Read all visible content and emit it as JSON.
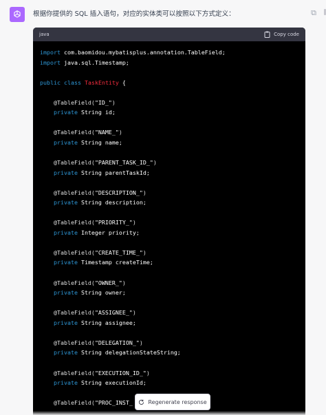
{
  "message": {
    "intro": "根据你提供的 SQL 插入语句，对应的实体类可以按照以下方式定义：",
    "avatar_icon": "openai-logo-icon",
    "avatar_color": "#ab68ff"
  },
  "code_block": {
    "language": "java",
    "copy_label": "Copy code",
    "lines": [
      {
        "parts": [
          {
            "t": "import",
            "c": "kw"
          },
          {
            "t": " com.baomidou.mybatisplus.annotation.TableField;",
            "c": ""
          }
        ]
      },
      {
        "parts": [
          {
            "t": "import",
            "c": "kw"
          },
          {
            "t": " java.sql.Timestamp;",
            "c": ""
          }
        ]
      },
      {
        "parts": []
      },
      {
        "parts": [
          {
            "t": "public",
            "c": "kw"
          },
          {
            "t": " ",
            "c": ""
          },
          {
            "t": "class",
            "c": "kw"
          },
          {
            "t": " ",
            "c": ""
          },
          {
            "t": "TaskEntity",
            "c": "cls"
          },
          {
            "t": " {",
            "c": ""
          }
        ]
      },
      {
        "parts": []
      },
      {
        "parts": [
          {
            "t": "    @TableField(",
            "c": "anno"
          },
          {
            "t": "\"ID_\"",
            "c": "str"
          },
          {
            "t": ")",
            "c": "anno"
          }
        ]
      },
      {
        "parts": [
          {
            "t": "    ",
            "c": ""
          },
          {
            "t": "private",
            "c": "kw"
          },
          {
            "t": " String id;",
            "c": ""
          }
        ]
      },
      {
        "parts": []
      },
      {
        "parts": [
          {
            "t": "    @TableField(",
            "c": "anno"
          },
          {
            "t": "\"NAME_\"",
            "c": "str"
          },
          {
            "t": ")",
            "c": "anno"
          }
        ]
      },
      {
        "parts": [
          {
            "t": "    ",
            "c": ""
          },
          {
            "t": "private",
            "c": "kw"
          },
          {
            "t": " String name;",
            "c": ""
          }
        ]
      },
      {
        "parts": []
      },
      {
        "parts": [
          {
            "t": "    @TableField(",
            "c": "anno"
          },
          {
            "t": "\"PARENT_TASK_ID_\"",
            "c": "str"
          },
          {
            "t": ")",
            "c": "anno"
          }
        ]
      },
      {
        "parts": [
          {
            "t": "    ",
            "c": ""
          },
          {
            "t": "private",
            "c": "kw"
          },
          {
            "t": " String parentTaskId;",
            "c": ""
          }
        ]
      },
      {
        "parts": []
      },
      {
        "parts": [
          {
            "t": "    @TableField(",
            "c": "anno"
          },
          {
            "t": "\"DESCRIPTION_\"",
            "c": "str"
          },
          {
            "t": ")",
            "c": "anno"
          }
        ]
      },
      {
        "parts": [
          {
            "t": "    ",
            "c": ""
          },
          {
            "t": "private",
            "c": "kw"
          },
          {
            "t": " String description;",
            "c": ""
          }
        ]
      },
      {
        "parts": []
      },
      {
        "parts": [
          {
            "t": "    @TableField(",
            "c": "anno"
          },
          {
            "t": "\"PRIORITY_\"",
            "c": "str"
          },
          {
            "t": ")",
            "c": "anno"
          }
        ]
      },
      {
        "parts": [
          {
            "t": "    ",
            "c": ""
          },
          {
            "t": "private",
            "c": "kw"
          },
          {
            "t": " Integer priority;",
            "c": ""
          }
        ]
      },
      {
        "parts": []
      },
      {
        "parts": [
          {
            "t": "    @TableField(",
            "c": "anno"
          },
          {
            "t": "\"CREATE_TIME_\"",
            "c": "str"
          },
          {
            "t": ")",
            "c": "anno"
          }
        ]
      },
      {
        "parts": [
          {
            "t": "    ",
            "c": ""
          },
          {
            "t": "private",
            "c": "kw"
          },
          {
            "t": " Timestamp createTime;",
            "c": ""
          }
        ]
      },
      {
        "parts": []
      },
      {
        "parts": [
          {
            "t": "    @TableField(",
            "c": "anno"
          },
          {
            "t": "\"OWNER_\"",
            "c": "str"
          },
          {
            "t": ")",
            "c": "anno"
          }
        ]
      },
      {
        "parts": [
          {
            "t": "    ",
            "c": ""
          },
          {
            "t": "private",
            "c": "kw"
          },
          {
            "t": " String owner;",
            "c": ""
          }
        ]
      },
      {
        "parts": []
      },
      {
        "parts": [
          {
            "t": "    @TableField(",
            "c": "anno"
          },
          {
            "t": "\"ASSIGNEE_\"",
            "c": "str"
          },
          {
            "t": ")",
            "c": "anno"
          }
        ]
      },
      {
        "parts": [
          {
            "t": "    ",
            "c": ""
          },
          {
            "t": "private",
            "c": "kw"
          },
          {
            "t": " String assignee;",
            "c": ""
          }
        ]
      },
      {
        "parts": []
      },
      {
        "parts": [
          {
            "t": "    @TableField(",
            "c": "anno"
          },
          {
            "t": "\"DELEGATION_\"",
            "c": "str"
          },
          {
            "t": ")",
            "c": "anno"
          }
        ]
      },
      {
        "parts": [
          {
            "t": "    ",
            "c": ""
          },
          {
            "t": "private",
            "c": "kw"
          },
          {
            "t": " String delegationStateString;",
            "c": ""
          }
        ]
      },
      {
        "parts": []
      },
      {
        "parts": [
          {
            "t": "    @TableField(",
            "c": "anno"
          },
          {
            "t": "\"EXECUTION_ID_\"",
            "c": "str"
          },
          {
            "t": ")",
            "c": "anno"
          }
        ]
      },
      {
        "parts": [
          {
            "t": "    ",
            "c": ""
          },
          {
            "t": "private",
            "c": "kw"
          },
          {
            "t": " String executionId;",
            "c": ""
          }
        ]
      },
      {
        "parts": []
      },
      {
        "parts": [
          {
            "t": "    @TableField(",
            "c": "anno"
          },
          {
            "t": "\"PROC_INST_",
            "c": "str"
          }
        ]
      }
    ]
  },
  "regenerate": {
    "label": "Regenerate response",
    "icon": "refresh-icon"
  },
  "colors": {
    "keyword": "#2e95d3",
    "class_name": "#f22c3d",
    "code_bg": "#000000",
    "code_header_bg": "#343541"
  }
}
